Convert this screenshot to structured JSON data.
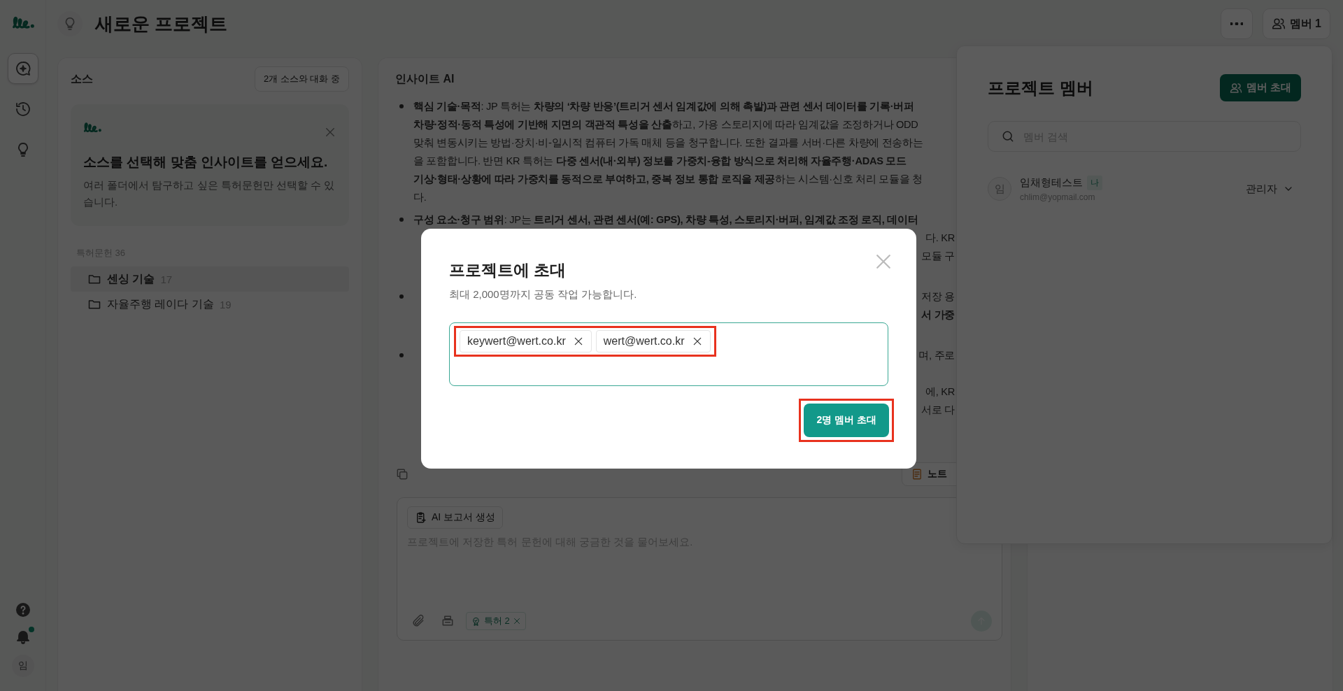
{
  "rail": {
    "nav": [
      {
        "kind": "new-chat",
        "selected": true
      },
      {
        "kind": "history",
        "selected": false
      },
      {
        "kind": "insight",
        "selected": false
      }
    ],
    "bell_unread": true,
    "avatar": "임"
  },
  "header": {
    "title": "새로운 프로젝트",
    "members_button": "멤버 1"
  },
  "sources": {
    "title": "소스",
    "chat_badge": "2개 소스와 대화 중",
    "notice": {
      "title": "소스를 선택해 맞춤 인사이트를 얻으세요.",
      "text": "여러 폴더에서 탐구하고 싶은 특허문헌만 선택할 수 있습니다."
    },
    "count_label": "특허문헌 36",
    "folders": [
      {
        "name": "센싱 기술",
        "count": "17",
        "selected": true
      },
      {
        "name": "자율주행 레이다 기술",
        "count": "19",
        "selected": false
      }
    ]
  },
  "insight": {
    "title": "인사이트 AI",
    "lines": [
      {
        "bullet": true,
        "left": "**핵심 기술·목적**: JP 특허는 **차량의 ‘차량 반응’(트리거 센서 임계값에 의해 촉발)과 관련 센서 데이터를 기록·버퍼**"
      },
      {
        "bullet": false,
        "left": "**차량·정적·동적 특성에 기반해 지면의 객관적 특성을 산출**하고, 가용 스토리지에 따라 임계값을 조정하거나 ODD"
      },
      {
        "bullet": false,
        "left": "맞춰 변동시키는 방법·장치·비-일시적 컴퓨터 가독 매체 등을 청구합니다. 또한 결과를 서버·다른 차량에 전송하는"
      },
      {
        "bullet": false,
        "left": "을 포함합니다. 반면 KR 특허는 **다중 센서(내·외부) 정보를 가중치-융합 방식으로 처리해 자율주행·ADAS 모드**"
      },
      {
        "bullet": false,
        "left": "**기상·형태·상황에 따라 가중치를 동적으로 부여하고, 중복 정보 통합 로직을 제공**하는 시스템·신호 처리 모듈을 청"
      },
      {
        "bullet": false,
        "left": "다."
      },
      {
        "bullet": true,
        "left": "**구성 요소·청구 범위**: JP는 **트리거 센서, 관련 센서(예: GPS), 차량 특성, 스토리지·버퍼, 임계값 조정 로직, 데이터**"
      },
      {
        "bullet": false,
        "right": "다. KR"
      },
      {
        "bullet": false,
        "right": "모듈 구"
      },
      {
        "bullet": false
      },
      {
        "bullet": true,
        "right": "저장 용"
      },
      {
        "bullet": false,
        "right": "서 가중",
        "right_bold": true
      },
      {
        "bullet": false
      },
      {
        "bullet": true,
        "right": "며, 주로"
      },
      {
        "bullet": false
      },
      {
        "bullet": false,
        "right": "에, KR"
      },
      {
        "bullet": false,
        "right": "서로 다"
      },
      {
        "bullet": false
      }
    ],
    "note_button": "노트"
  },
  "composer": {
    "report_button": "AI 보고서 생성",
    "placeholder": "프로젝트에 저장한 특허 문헌에 대해 궁금한 것을 물어보세요.",
    "tag": "특허 2"
  },
  "members_panel": {
    "title": "프로젝트 멤버",
    "invite_button": "멤버 초대",
    "search_placeholder": "멤버 검색",
    "members": [
      {
        "avatar": "임",
        "name": "임채형테스트",
        "badge": "나",
        "email": "chlim@yopmail.com",
        "role": "관리자"
      }
    ]
  },
  "modal": {
    "title": "프로젝트에 초대",
    "subtitle": "최대 2,000명까지 공동 작업 가능합니다.",
    "emails": [
      "keywert@wert.co.kr",
      "wert@wert.co.kr"
    ],
    "emails_highlighted": true,
    "submit": "2명 멤버 초대",
    "submit_highlighted": true
  }
}
